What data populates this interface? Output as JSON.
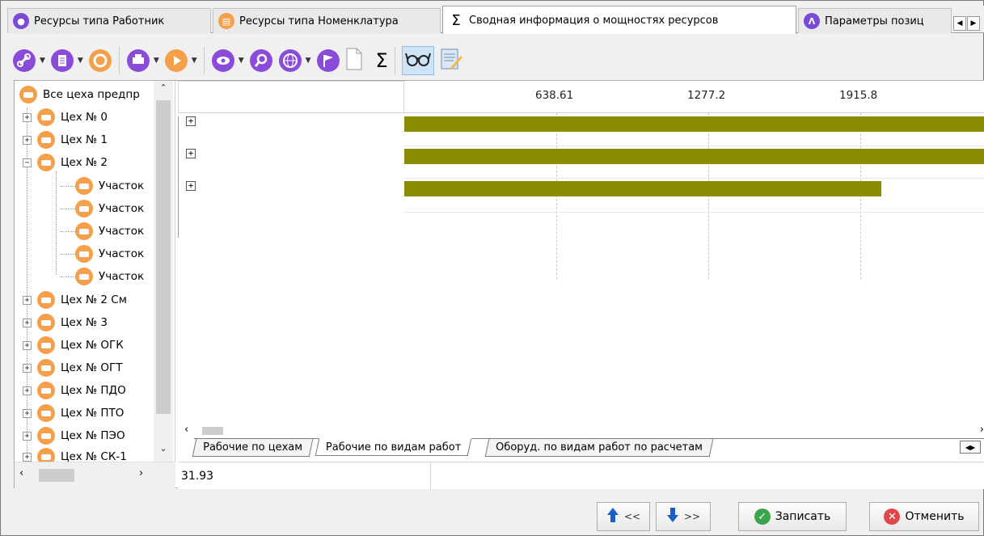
{
  "tabs": [
    {
      "label": "Ресурсы типа Работник",
      "icon": "worker-icon",
      "color": "#7b4ad6"
    },
    {
      "label": "Ресурсы типа Номенклатура",
      "icon": "nomenclature-icon",
      "color": "#f4a04a"
    },
    {
      "label": "Сводная информация о мощностях ресурсов",
      "icon": "sigma-icon",
      "active": true
    },
    {
      "label": "Параметры позиц",
      "icon": "compass-icon",
      "color": "#7b4ad6"
    }
  ],
  "tree": {
    "root": "Все цеха предпр",
    "items": [
      {
        "label": "Цех № 0",
        "expanded": false
      },
      {
        "label": "Цех № 1",
        "expanded": false
      },
      {
        "label": "Цех № 2",
        "expanded": true
      },
      {
        "label": "Участок",
        "child": true
      },
      {
        "label": "Участок",
        "child": true
      },
      {
        "label": "Участок",
        "child": true
      },
      {
        "label": "Участок",
        "child": true
      },
      {
        "label": "Участок",
        "child": true
      },
      {
        "label": "Цех № 2 См",
        "expanded": false
      },
      {
        "label": "Цех № 3",
        "expanded": false
      },
      {
        "label": "Цех № ОГК",
        "expanded": false
      },
      {
        "label": "Цех № ОГТ",
        "expanded": false
      },
      {
        "label": "Цех № ПДО",
        "expanded": false
      },
      {
        "label": "Цех № ПТО",
        "expanded": false
      },
      {
        "label": "Цех № ПЭО",
        "expanded": false
      },
      {
        "label": "Цех № СК-1",
        "expanded": false
      }
    ]
  },
  "chart": {
    "ticks": [
      "638.61",
      "1277.2",
      "1915.8"
    ],
    "bar_color": "#8b8b00",
    "rows": [
      {
        "fill": 1.0
      },
      {
        "fill": 1.0
      },
      {
        "fill": 0.82
      }
    ]
  },
  "sheets": [
    "Рабочие по цехам",
    "Рабочие по видам работ",
    "Оборуд. по видам работ по расчетам"
  ],
  "status": {
    "value": "31.93"
  },
  "buttons": {
    "up": "<<",
    "down": ">>",
    "save": "Записать",
    "cancel": "Отменить"
  },
  "colors": {
    "accent_orange": "#f4a04a",
    "accent_purple": "#7b4ad6",
    "ok_green": "#3aa54a",
    "cancel_red": "#e04848"
  }
}
